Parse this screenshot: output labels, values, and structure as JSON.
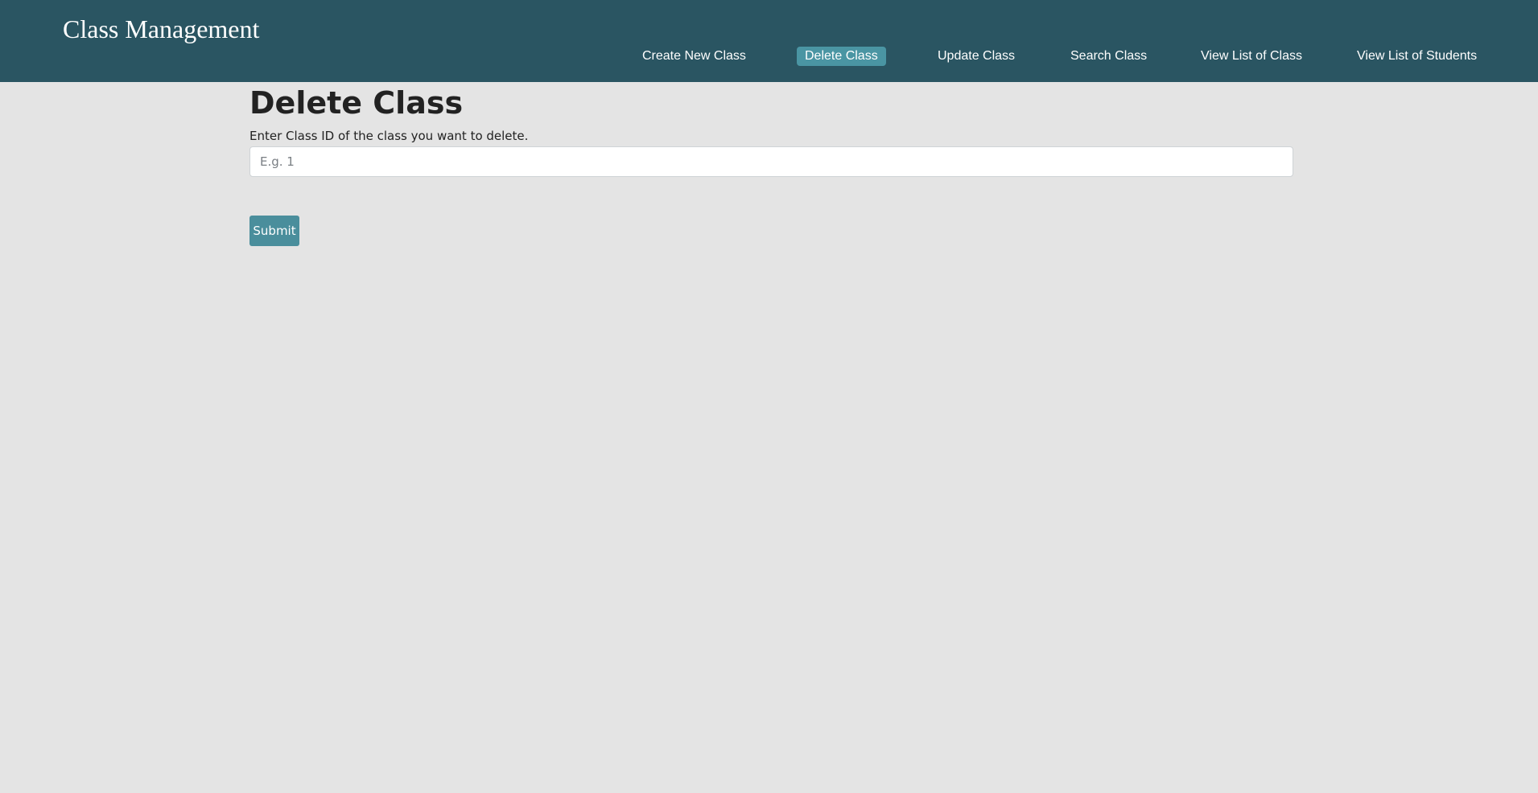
{
  "header": {
    "brand": "Class Management",
    "nav": [
      {
        "label": "Create New Class",
        "active": false
      },
      {
        "label": "Delete Class",
        "active": true
      },
      {
        "label": "Update Class",
        "active": false
      },
      {
        "label": "Search Class",
        "active": false
      },
      {
        "label": "View List of Class",
        "active": false
      },
      {
        "label": "View List of Students",
        "active": false
      }
    ]
  },
  "main": {
    "title": "Delete Class",
    "field_label": "Enter Class ID of the class you want to delete.",
    "input": {
      "value": "",
      "placeholder": "E.g. 1"
    },
    "submit_label": "Submit"
  },
  "colors": {
    "header_bg": "#2a5562",
    "active_nav_bg": "#4a95a3",
    "page_bg": "#e4e4e4",
    "button_bg": "#4a8e9c"
  }
}
